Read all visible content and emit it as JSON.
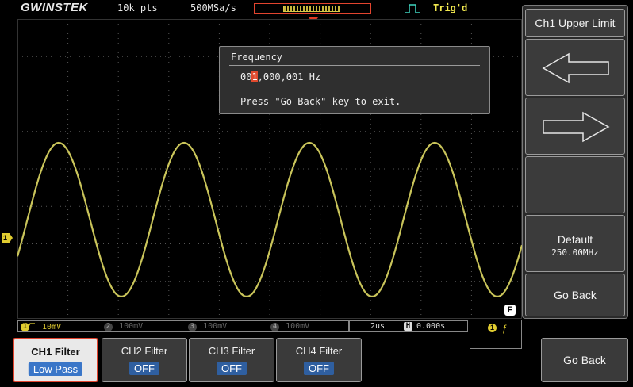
{
  "topbar": {
    "brand": "GWINSTEK",
    "record_length": "10k pts",
    "sample_rate": "500MSa/s",
    "trigger_status": "Trig'd"
  },
  "frequency_dialog": {
    "title": "Frequency",
    "value_cursor_prefix": "00",
    "value_cursor_digit": "1",
    "value_rest": ",000,001 Hz",
    "hint": "Press \"Go Back\" key to exit."
  },
  "side_menu": {
    "title": "Ch1 Upper Limit",
    "left_arrow": "left-arrow-icon",
    "right_arrow": "right-arrow-icon",
    "default_label": "Default",
    "default_value": "250.00MHz",
    "go_back": "Go Back"
  },
  "channel_bar": {
    "ch1": {
      "num": "1",
      "coupling_icon": "dc-coupling-bw-icon",
      "scale": "10mV",
      "color": "#e0cc30"
    },
    "ch2": {
      "num": "2",
      "scale": "100mV",
      "color": "#555555"
    },
    "ch3": {
      "num": "3",
      "scale": "100mV",
      "color": "#555555"
    },
    "ch4": {
      "num": "4",
      "scale": "100mV",
      "color": "#555555"
    }
  },
  "horizontal": {
    "timebase": "2us",
    "position": "0.000s"
  },
  "ch1_marker": "1",
  "filter_badge": "F",
  "softkeys": [
    {
      "label": "CH1 Filter",
      "value": "Low Pass",
      "active": true
    },
    {
      "label": "CH2 Filter",
      "value": "OFF",
      "active": false
    },
    {
      "label": "CH3 Filter",
      "value": "OFF",
      "active": false
    },
    {
      "label": "CH4 Filter",
      "value": "OFF",
      "active": false
    }
  ],
  "go_back_bottom": "Go Back",
  "colors": {
    "ch1": "#e0cc30",
    "trace": "#c9c45a",
    "accent": "#e2442e",
    "selected_value": "#3a76c8"
  }
}
